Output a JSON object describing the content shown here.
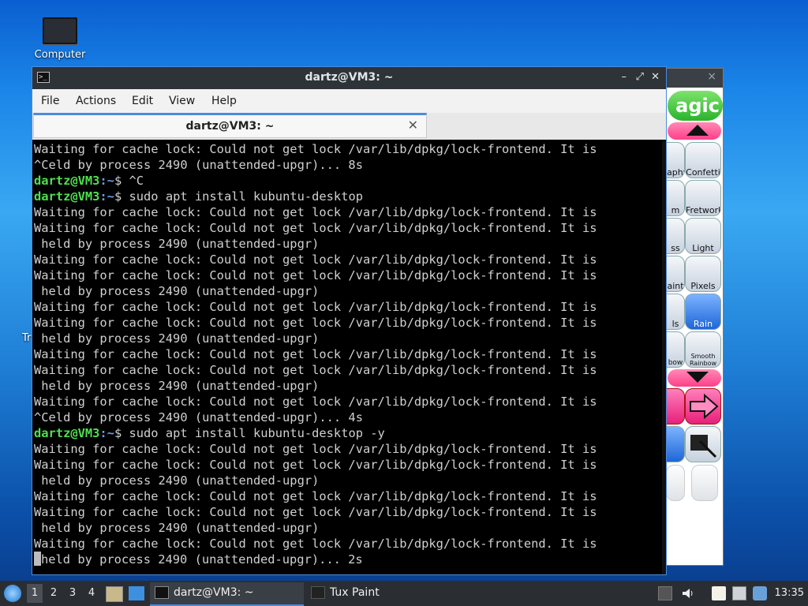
{
  "desktop": {
    "icons": [
      {
        "label": "Computer"
      },
      {
        "label": "Tr"
      }
    ]
  },
  "tuxpaint": {
    "title_close": "×",
    "magic_label": "agic",
    "tools": [
      "aphy",
      "Confetti",
      "m",
      "Fretwork",
      "ss",
      "Light",
      "aint",
      "Pixels",
      "ls",
      "Rain",
      "bow",
      "Smooth Rainbow"
    ]
  },
  "terminal": {
    "title": "dartz@VM3: ~",
    "controls": {
      "minimize": "–",
      "maximize": "⤢",
      "close": "✕"
    },
    "menu": [
      "File",
      "Actions",
      "Edit",
      "View",
      "Help"
    ],
    "tab": {
      "label": "dartz@VM3: ~",
      "close": "✕"
    },
    "prompt_user": "dartz@VM3",
    "prompt_path": ":~",
    "lines": [
      {
        "t": "Waiting for cache lock: Could not get lock /var/lib/dpkg/lock-frontend. It is"
      },
      {
        "t": "^Celd by process 2490 (unattended-upgr)... 8s"
      },
      {
        "cmd": "$ ^C"
      },
      {
        "cmd": "$ sudo apt install kubuntu-desktop"
      },
      {
        "t": "Waiting for cache lock: Could not get lock /var/lib/dpkg/lock-frontend. It is"
      },
      {
        "t": "Waiting for cache lock: Could not get lock /var/lib/dpkg/lock-frontend. It is"
      },
      {
        "t": " held by process 2490 (unattended-upgr)"
      },
      {
        "t": "Waiting for cache lock: Could not get lock /var/lib/dpkg/lock-frontend. It is"
      },
      {
        "t": "Waiting for cache lock: Could not get lock /var/lib/dpkg/lock-frontend. It is"
      },
      {
        "t": " held by process 2490 (unattended-upgr)"
      },
      {
        "t": "Waiting for cache lock: Could not get lock /var/lib/dpkg/lock-frontend. It is"
      },
      {
        "t": "Waiting for cache lock: Could not get lock /var/lib/dpkg/lock-frontend. It is"
      },
      {
        "t": " held by process 2490 (unattended-upgr)"
      },
      {
        "t": "Waiting for cache lock: Could not get lock /var/lib/dpkg/lock-frontend. It is"
      },
      {
        "t": "Waiting for cache lock: Could not get lock /var/lib/dpkg/lock-frontend. It is"
      },
      {
        "t": " held by process 2490 (unattended-upgr)"
      },
      {
        "t": "Waiting for cache lock: Could not get lock /var/lib/dpkg/lock-frontend. It is"
      },
      {
        "t": "^Celd by process 2490 (unattended-upgr)... 4s"
      },
      {
        "cmd": "$ sudo apt install kubuntu-desktop -y"
      },
      {
        "t": "Waiting for cache lock: Could not get lock /var/lib/dpkg/lock-frontend. It is"
      },
      {
        "t": "Waiting for cache lock: Could not get lock /var/lib/dpkg/lock-frontend. It is"
      },
      {
        "t": " held by process 2490 (unattended-upgr)"
      },
      {
        "t": "Waiting for cache lock: Could not get lock /var/lib/dpkg/lock-frontend. It is"
      },
      {
        "t": "Waiting for cache lock: Could not get lock /var/lib/dpkg/lock-frontend. It is"
      },
      {
        "t": " held by process 2490 (unattended-upgr)"
      },
      {
        "t": "Waiting for cache lock: Could not get lock /var/lib/dpkg/lock-frontend. It is"
      },
      {
        "t": "held by process 2490 (unattended-upgr)... 2s",
        "cursor": true
      }
    ]
  },
  "taskbar": {
    "workspaces": [
      "1",
      "2",
      "3",
      "4"
    ],
    "active_workspace": "1",
    "tasks": [
      {
        "label": "dartz@VM3: ~",
        "icon": "terminal-icon",
        "active": true
      },
      {
        "label": "Tux Paint",
        "icon": "tux-icon",
        "active": false
      }
    ],
    "clock": "13:35"
  },
  "colors": {
    "prompt_user": "#4ee14e",
    "prompt_path": "#6a9cf0",
    "accent": "#4a8be0"
  }
}
